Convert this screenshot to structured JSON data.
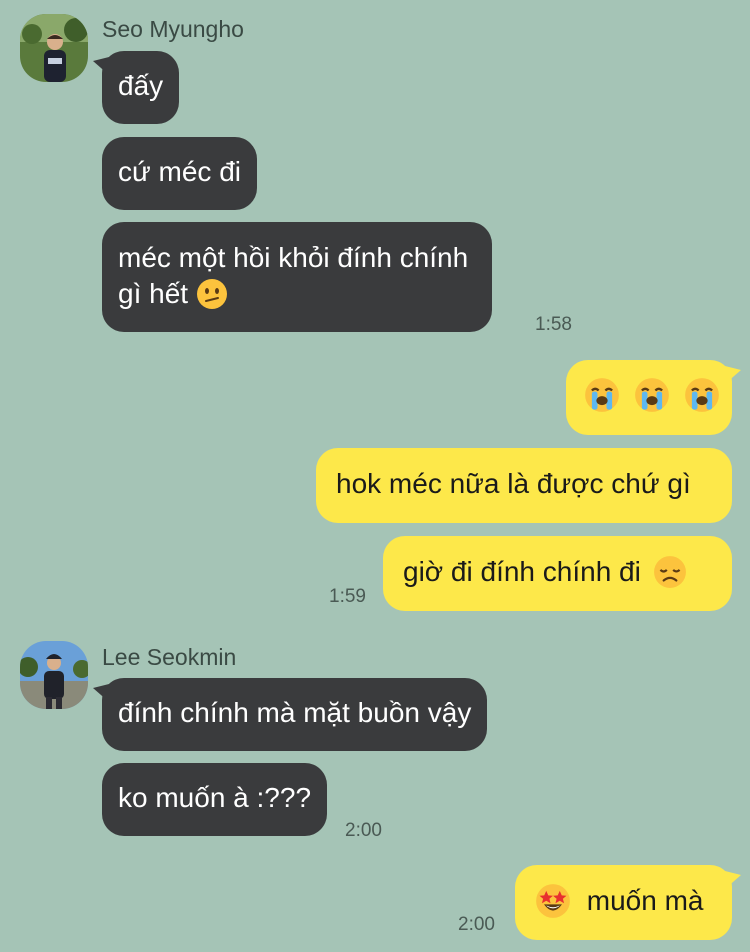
{
  "messages": [
    {
      "sender": "Seo Myungho",
      "avatar": "avatar-seo-myungho"
    },
    {
      "text": "đấy"
    },
    {
      "text": "cứ méc đi"
    },
    {
      "line1": "méc một hồi khỏi đính chính",
      "line2": "gì hết",
      "emoji": "confused-face",
      "time": "1:58"
    },
    {
      "emoji": [
        "loudly-crying-face",
        "loudly-crying-face",
        "loudly-crying-face"
      ]
    },
    {
      "text": "hok méc nữa là được chứ gì"
    },
    {
      "text": "giờ đi đính chính đi",
      "emoji": "disappointed-face",
      "time": "1:59"
    },
    {
      "sender": "Lee Seokmin",
      "avatar": "avatar-lee-seokmin"
    },
    {
      "text": "đính chính mà mặt buồn vậy"
    },
    {
      "text": "ko muốn à :???",
      "time": "2:00"
    },
    {
      "emoji": "star-struck-face",
      "text": "muốn mà",
      "time": "2:00"
    }
  ],
  "colors": {
    "background": "#a5c4b6",
    "incoming_bubble": "#3a3b3d",
    "outgoing_bubble": "#fde84a"
  }
}
